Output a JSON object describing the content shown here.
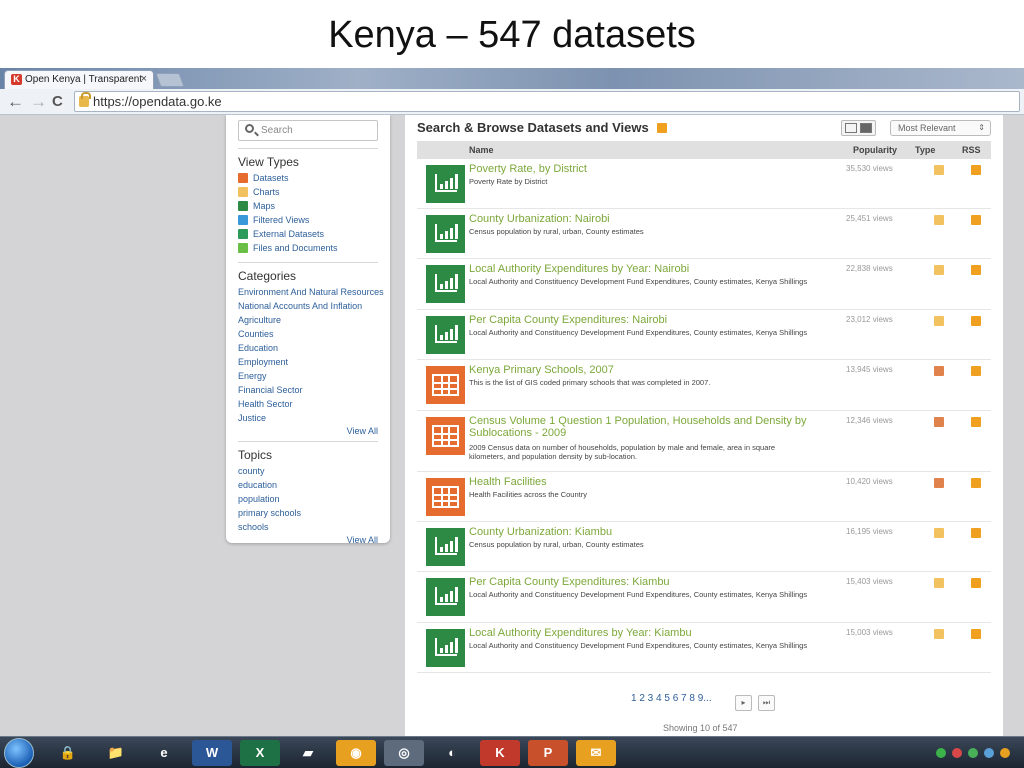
{
  "slide": {
    "title": "Kenya – 547 datasets"
  },
  "browser": {
    "tab_label": "Open Kenya | Transparent",
    "tab_close": "×",
    "tab_favicon_letter": "K",
    "url": "https://opendata.go.ke",
    "nav": {
      "back": "←",
      "forward": "→",
      "reload": "C"
    }
  },
  "sidebar": {
    "search_placeholder": "Search",
    "view_types_heading": "View Types",
    "view_types": [
      {
        "label": "Datasets",
        "color": "#e56b2e"
      },
      {
        "label": "Charts",
        "color": "#f2c160"
      },
      {
        "label": "Maps",
        "color": "#2c8a45"
      },
      {
        "label": "Filtered Views",
        "color": "#3a9ad9"
      },
      {
        "label": "External Datasets",
        "color": "#2c9a5a"
      },
      {
        "label": "Files and Documents",
        "color": "#6abf45"
      }
    ],
    "categories_heading": "Categories",
    "categories": [
      "Environment And Natural Resources",
      "National Accounts And Inflation",
      "Agriculture",
      "Counties",
      "Education",
      "Employment",
      "Energy",
      "Financial Sector",
      "Health Sector",
      "Justice"
    ],
    "categories_view_all": "View All",
    "topics_heading": "Topics",
    "topics": [
      "county",
      "education",
      "population",
      "primary schools",
      "schools"
    ],
    "topics_view_all": "View All"
  },
  "main": {
    "heading": "Search & Browse Datasets and Views",
    "sort_value": "Most Relevant",
    "sort_arrow": "⇕",
    "columns": {
      "name": "Name",
      "popularity": "Popularity",
      "type": "Type",
      "rss": "RSS"
    },
    "rows": [
      {
        "title": "Poverty Rate, by District",
        "desc": "Poverty Rate by District",
        "views": "35,530 views",
        "kind": "chart"
      },
      {
        "title": "County Urbanization: Nairobi",
        "desc": "Census population by rural, urban, County estimates",
        "views": "25,451 views",
        "kind": "chart"
      },
      {
        "title": "Local Authority Expenditures by Year: Nairobi",
        "desc": "Local Authority and Constituency Development Fund Expenditures, County estimates, Kenya Shillings",
        "views": "22,838 views",
        "kind": "chart"
      },
      {
        "title": "Per Capita County Expenditures: Nairobi",
        "desc": "Local Authority and Constituency Development Fund Expenditures, County estimates, Kenya Shillings",
        "views": "23,012 views",
        "kind": "chart"
      },
      {
        "title": "Kenya Primary Schools, 2007",
        "desc": "This is the list of GIS coded primary schools that was completed in 2007.",
        "views": "13,945 views",
        "kind": "table"
      },
      {
        "title": "Census Volume 1 Question 1 Population, Households and Density by Sublocations - 2009",
        "desc": "2009 Census data on number of households, population by male and female, area in square kilometers, and population density by sub-location.",
        "views": "12,346 views",
        "kind": "table"
      },
      {
        "title": "Health Facilities",
        "desc": "Health Facilities across the Country",
        "views": "10,420 views",
        "kind": "table"
      },
      {
        "title": "County Urbanization: Kiambu",
        "desc": "Census population by rural, urban, County estimates",
        "views": "16,195 views",
        "kind": "chart"
      },
      {
        "title": "Per Capita County Expenditures: Kiambu",
        "desc": "Local Authority and Constituency Development Fund Expenditures, County estimates, Kenya Shillings",
        "views": "15,403 views",
        "kind": "chart"
      },
      {
        "title": "Local Authority Expenditures by Year: Kiambu",
        "desc": "Local Authority and Constituency Development Fund Expenditures, County estimates, Kenya Shillings",
        "views": "15,003 views",
        "kind": "chart"
      }
    ],
    "pager": {
      "pages": "1 2 3 4 5 6 7 8 9...",
      "next": "▸",
      "last": "⏭"
    },
    "showing": "Showing 10 of 547"
  },
  "taskbar": {
    "apps": [
      {
        "name": "security-app-icon",
        "glyph": "🔒",
        "bg": "transparent"
      },
      {
        "name": "file-explorer-icon",
        "glyph": "📁",
        "bg": "transparent"
      },
      {
        "name": "internet-explorer-icon",
        "glyph": "e",
        "bg": "transparent"
      },
      {
        "name": "word-icon",
        "glyph": "W",
        "bg": "#2b5797"
      },
      {
        "name": "excel-icon",
        "glyph": "X",
        "bg": "#1e7145"
      },
      {
        "name": "notes-app-icon",
        "glyph": "▰",
        "bg": "transparent"
      },
      {
        "name": "media-app-icon",
        "glyph": "◉",
        "bg": "#e8a020"
      },
      {
        "name": "chrome-icon",
        "glyph": "◎",
        "bg": "#5d6b7d"
      },
      {
        "name": "google-earth-icon",
        "glyph": "◐",
        "bg": "transparent"
      },
      {
        "name": "app-k-icon",
        "glyph": "K",
        "bg": "#c0392b"
      },
      {
        "name": "powerpoint-icon",
        "glyph": "P",
        "bg": "#c8502a"
      },
      {
        "name": "mail-app-icon",
        "glyph": "✉",
        "bg": "#e8a020"
      }
    ]
  }
}
